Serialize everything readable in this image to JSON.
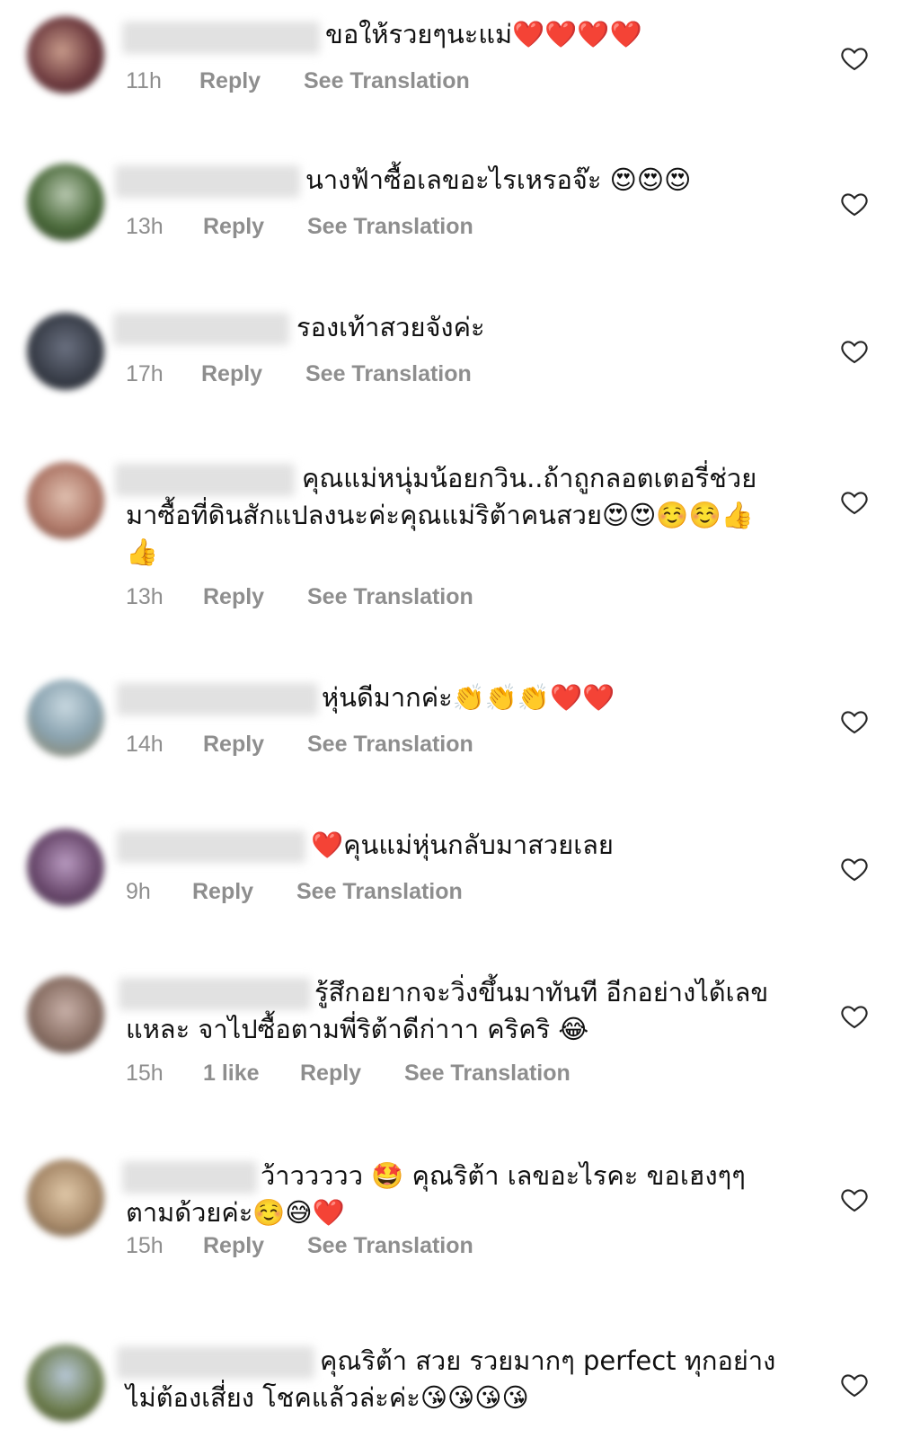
{
  "comments": [
    {
      "text": "ขอให้รวยๆนะแม่❤️❤️❤️❤️",
      "time": "11h",
      "likes": "",
      "reply": "Reply",
      "translate": "See Translation",
      "avatar_color": "#6e3b3f"
    },
    {
      "text": "นางฟ้าซื้อเลขอะไรเหรอจ๊ะ 😍😍😍",
      "time": "13h",
      "likes": "",
      "reply": "Reply",
      "translate": "See Translation",
      "avatar_color": "#4b6a3b"
    },
    {
      "text": "รองเท้าสวยจังค่ะ",
      "time": "17h",
      "likes": "",
      "reply": "Reply",
      "translate": "See Translation",
      "avatar_color": "#3a3f4a"
    },
    {
      "text": "คุณแม่หนุ่มน้อยกวิน..ถ้าถูกลอตเตอรี่ช่วยมาซื้อที่ดินสักแปลงนะค่ะคุณแม่ริต้าคนสวย😍😍☺️☺️👍👍",
      "time": "13h",
      "likes": "",
      "reply": "Reply",
      "translate": "See Translation",
      "avatar_color": "#b07a6a"
    },
    {
      "text": "หุ่นดีมากค่ะ👏👏👏❤️❤️",
      "time": "14h",
      "likes": "",
      "reply": "Reply",
      "translate": "See Translation",
      "avatar_color": "#8aa3b0"
    },
    {
      "text": "❤️คุนแม่หุ่นกลับมาสวยเลย",
      "time": "9h",
      "likes": "",
      "reply": "Reply",
      "translate": "See Translation",
      "avatar_color": "#6b4a6e"
    },
    {
      "text": "รู้สึกอยากจะวิ่งขึ้นมาทันที อีกอย่างได้เลขแหละ จาไปซื้อตามพี่ริต้าดีก่าาา คริคริ 😂",
      "time": "15h",
      "likes": "1 like",
      "reply": "Reply",
      "translate": "See Translation",
      "avatar_color": "#8a7065"
    },
    {
      "text": "ว้าววววว 🤩 คุณริต้า เลขอะไรคะ ขอเฮงๆๆตามด้วยค่ะ☺️😅❤️",
      "time": "15h",
      "likes": "",
      "reply": "Reply",
      "translate": "See Translation",
      "avatar_color": "#a88a6a"
    },
    {
      "text": "คุณริต้า สวย รวยมากๆ perfect ทุกอย่าง ไม่ต้องเสี่ยง โชคแล้วล่ะค่ะ😘😘😘😘",
      "time": "",
      "likes": "",
      "reply": "",
      "translate": "",
      "avatar_color": "#6a7a4a"
    }
  ]
}
